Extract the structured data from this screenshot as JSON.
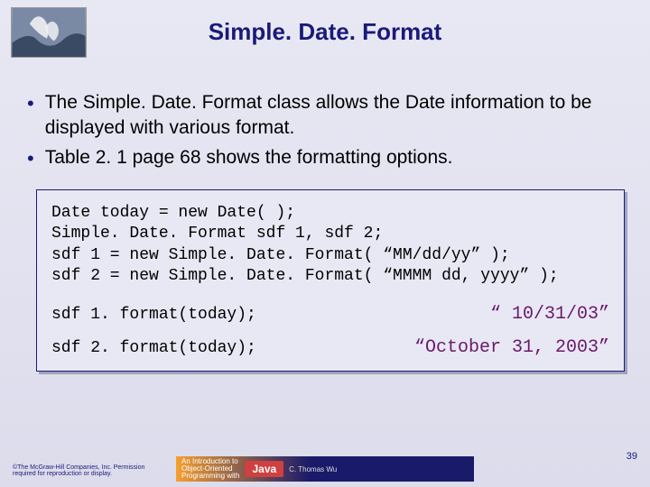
{
  "title": "Simple. Date. Format",
  "bullets": [
    "The Simple. Date. Format class allows the Date information to be displayed with various format.",
    "Table 2. 1 page 68 shows the formatting options."
  ],
  "code_block": [
    "Date today = new Date( );",
    "Simple. Date. Format sdf 1, sdf 2;",
    "sdf 1 = new Simple. Date. Format( “MM/dd/yy” );",
    "sdf 2 = new Simple. Date. Format( “MMMM dd, yyyy” );"
  ],
  "format_examples": [
    {
      "call": "sdf 1. format(today);",
      "result": "“ 10/31/03”"
    },
    {
      "call": "sdf 2. format(today);",
      "result": "“October 31, 2003”"
    }
  ],
  "footer": {
    "copyright": "©The McGraw-Hill Companies, Inc. Permission required for reproduction or display.",
    "banner_intro_line1": "An Introduction to",
    "banner_intro_line2": "Object-Oriented",
    "banner_intro_line3": "Programming with",
    "banner_java": "Java",
    "banner_author": "C. Thomas Wu"
  },
  "page_number": "39"
}
